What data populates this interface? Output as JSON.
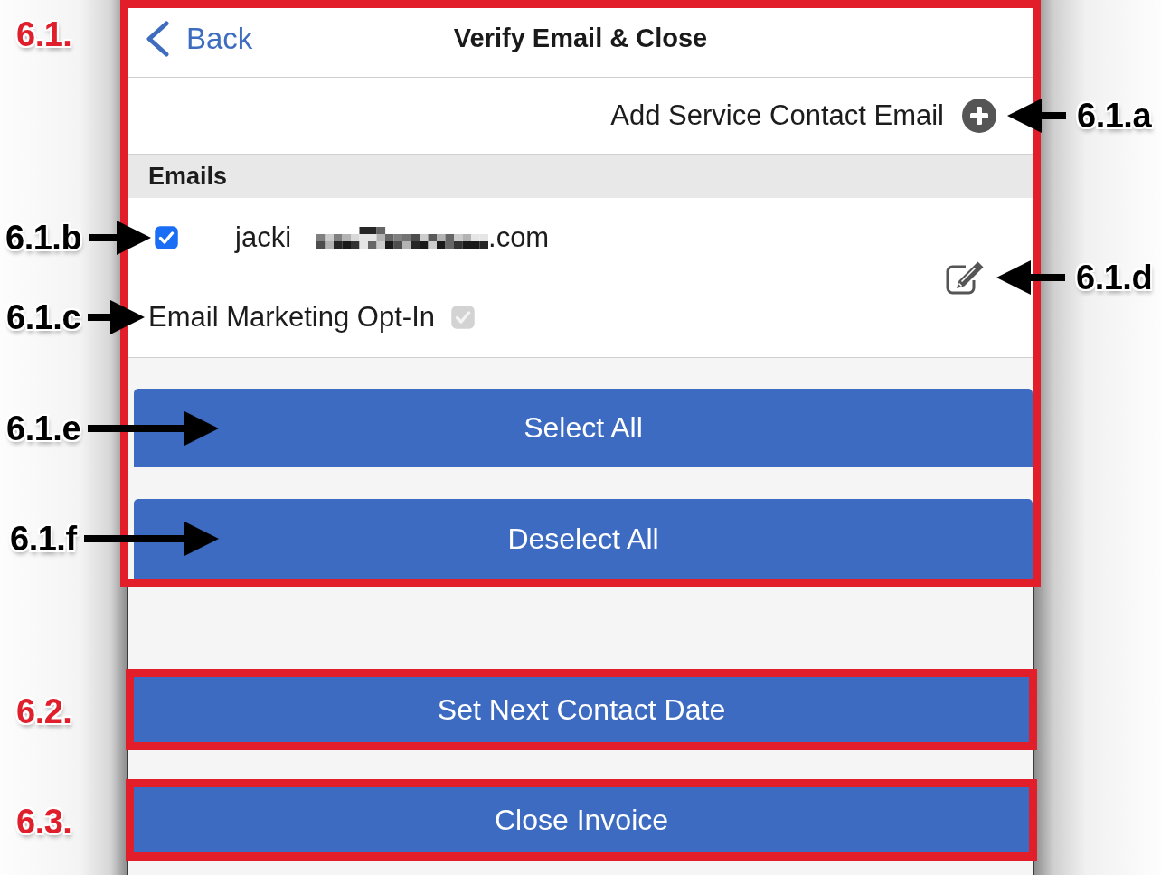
{
  "panel": {
    "callout": {
      "label": "6.1.",
      "kind": "section"
    },
    "nav_bar": {
      "back_label": "Back",
      "title": "Verify Email & Close"
    },
    "add_contact": {
      "label": "Add Service Contact Email",
      "callout": {
        "label": "6.1.a",
        "kind": "pointer"
      }
    },
    "emails_heading": "Emails",
    "entries": [
      {
        "address_start": "jacki",
        "address_end": ".com",
        "selected": true,
        "checkbox_callout": {
          "label": "6.1.b",
          "kind": "pointer"
        },
        "opt_in": {
          "label": "Email Marketing Opt-In",
          "checked": true,
          "disabled": true,
          "callout": {
            "label": "6.1.c",
            "kind": "pointer"
          }
        },
        "edit_callout": {
          "label": "6.1.d",
          "kind": "pointer"
        }
      }
    ],
    "list_buttons": [
      {
        "label": "Select All",
        "callout": {
          "label": "6.1.e",
          "kind": "pointer"
        }
      },
      {
        "label": "Deselect All",
        "callout": {
          "label": "6.1.f",
          "kind": "pointer"
        }
      }
    ]
  },
  "action_buttons": [
    {
      "label": "Set Next Contact Date",
      "callout": {
        "label": "6.2.",
        "kind": "section"
      }
    },
    {
      "label": "Close Invoice",
      "callout": {
        "label": "6.3.",
        "kind": "section"
      }
    }
  ]
}
